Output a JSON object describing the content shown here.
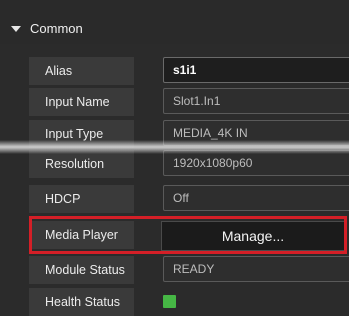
{
  "section": {
    "title": "Common"
  },
  "properties": [
    {
      "label": "Alias",
      "value": "s1i1"
    },
    {
      "label": "Input Name",
      "value": "Slot1.In1"
    },
    {
      "label": "Input Type",
      "value": "MEDIA_4K IN"
    },
    {
      "label": "Resolution",
      "value": "1920x1080p60"
    },
    {
      "label": "HDCP",
      "value": "Off"
    },
    {
      "label": "Media Player",
      "value": "Manage..."
    },
    {
      "label": "Module Status",
      "value": "READY"
    },
    {
      "label": "Health Status",
      "value": ""
    }
  ],
  "colors": {
    "highlight": "#d41f27",
    "health_ok": "#46b745"
  },
  "icons": {
    "section_toggle": "chevron-down-icon",
    "health_indicator": "status-green-square"
  }
}
